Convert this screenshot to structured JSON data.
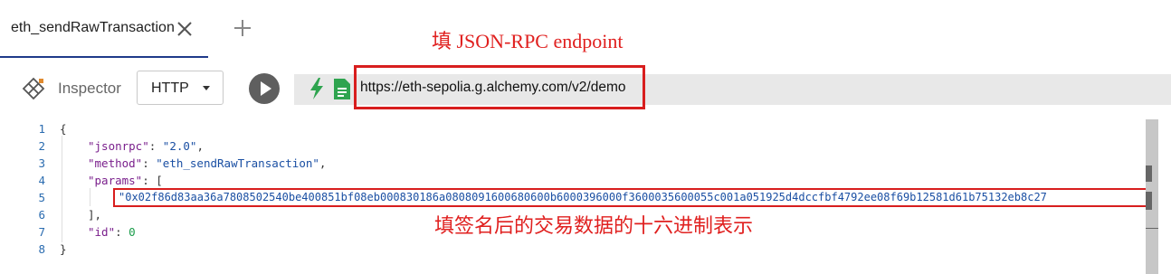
{
  "tab": {
    "title": "eth_sendRawTransaction"
  },
  "toolbar": {
    "inspector_label": "Inspector",
    "method": "HTTP",
    "url": "https://eth-sepolia.g.alchemy.com/v2/demo"
  },
  "annotations": {
    "endpoint_note": "填 JSON-RPC endpoint",
    "params_note": "填签名后的交易数据的十六进制表示"
  },
  "editor": {
    "line_numbers": [
      "1",
      "2",
      "3",
      "4",
      "5",
      "6",
      "7",
      "8"
    ],
    "open_brace": "{",
    "jsonrpc_key": "\"jsonrpc\"",
    "jsonrpc_value": "\"2.0\"",
    "method_key": "\"method\"",
    "method_value": "\"eth_sendRawTransaction\"",
    "params_key": "\"params\"",
    "param_value": "\"0x02f86d83aa36a7808502540be400851bf08eb000830186a0808091600680600b6000396000f3600035600055c001a051925d4dccfbf4792ee08f69b12581d61b75132eb8c27",
    "id_key": "\"id\"",
    "id_value": "0",
    "close_brace": "}"
  },
  "colors": {
    "annotation": "#e0201f",
    "run_button": "#5f5f5f",
    "icon_green": "#2ea44f",
    "tab_underline": "#1f3a8a"
  }
}
